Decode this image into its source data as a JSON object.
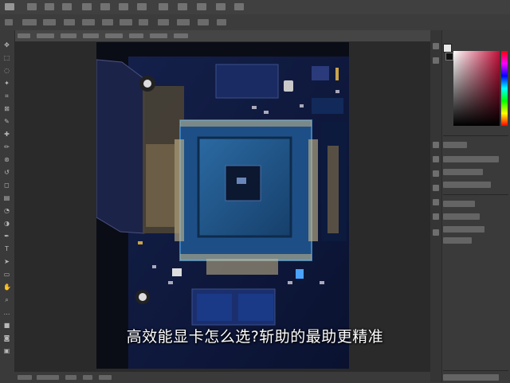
{
  "canvas": {
    "caption": "高效能显卡怎么选?斩助的最助更精准"
  },
  "colors": {
    "app_bg": "#3a3a3a",
    "workspace": "#2a2a2a",
    "canvas_bg": "#0b0d16",
    "chip": "#1f4c7b",
    "board": "#121a3a",
    "accent_red": "#c4103a"
  },
  "toolbar": {
    "tools": [
      "move-icon",
      "marquee-icon",
      "lasso-icon",
      "quick-select-icon",
      "crop-icon",
      "frame-icon",
      "eyedropper-icon",
      "healing-icon",
      "brush-icon",
      "clone-stamp-icon",
      "history-brush-icon",
      "eraser-icon",
      "gradient-icon",
      "blur-icon",
      "dodge-icon",
      "pen-icon",
      "type-icon",
      "path-select-icon",
      "shape-icon",
      "hand-icon",
      "zoom-icon",
      "edit-toolbar-icon",
      "foreground-color-icon",
      "quick-mask-icon",
      "screen-mode-icon"
    ]
  }
}
